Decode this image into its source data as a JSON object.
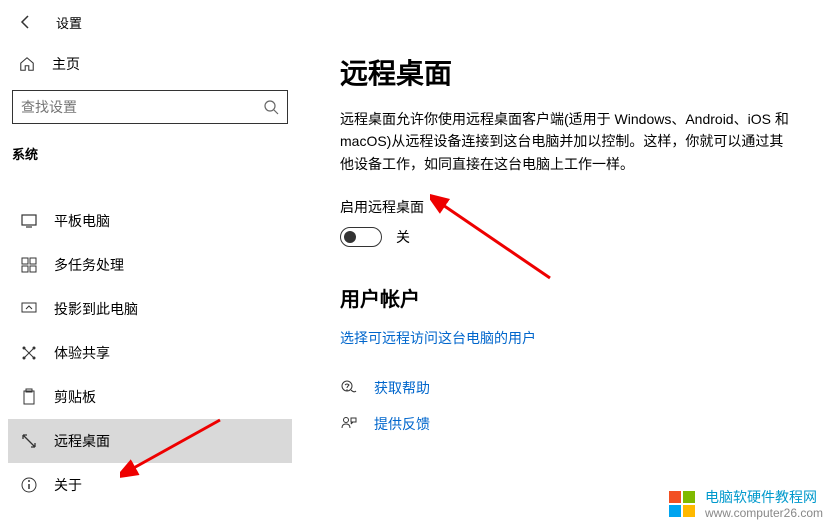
{
  "header": {
    "title": "设置"
  },
  "sidebar": {
    "home": "主页",
    "search_placeholder": "查找设置",
    "section": "系统",
    "items": [
      {
        "label": "平板电脑"
      },
      {
        "label": "多任务处理"
      },
      {
        "label": "投影到此电脑"
      },
      {
        "label": "体验共享"
      },
      {
        "label": "剪贴板"
      },
      {
        "label": "远程桌面"
      },
      {
        "label": "关于"
      }
    ]
  },
  "content": {
    "title": "远程桌面",
    "description": "远程桌面允许你使用远程桌面客户端(适用于 Windows、Android、iOS 和 macOS)从远程设备连接到这台电脑并加以控制。这样，你就可以通过其他设备工作，如同直接在这台电脑上工作一样。",
    "enable_label": "启用远程桌面",
    "toggle_state": "关",
    "accounts_heading": "用户帐户",
    "accounts_link": "选择可远程访问这台电脑的用户",
    "help": "获取帮助",
    "feedback": "提供反馈"
  },
  "watermark": {
    "text": "电脑软硬件教程网",
    "url": "www.computer26.com"
  }
}
